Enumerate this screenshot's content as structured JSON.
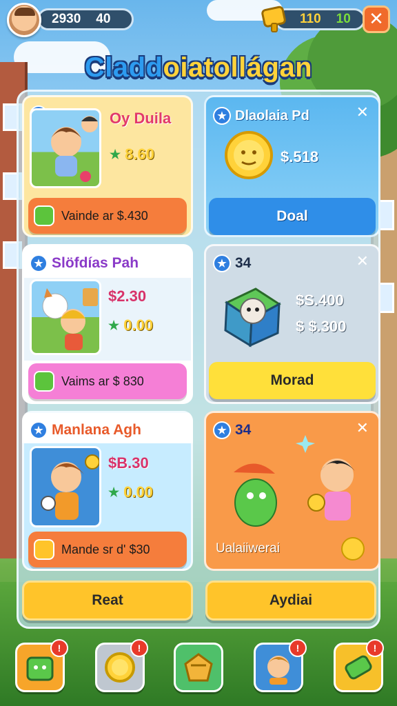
{
  "top_bar": {
    "coins_value": "2930",
    "coins_secondary": "40",
    "resource_a": "110",
    "resource_b": "10",
    "close_glyph": "✕"
  },
  "title": {
    "part1": "Cladd",
    "part2": "oiatollágan"
  },
  "cards": [
    {
      "title": "Oy Duila",
      "star_price": "8.60",
      "bar_label": "Vainde ar $.430",
      "colors": {
        "bg": "#fde6a0",
        "bar": "#f57d3c"
      }
    },
    {
      "title": "Dlaolaia Pd",
      "price": "$.518",
      "button_label": "Doal",
      "colors": {
        "bg": "#6cc0f2",
        "button": "#2f8ee8"
      }
    },
    {
      "title": "Slöfdías Pah",
      "price": "$2.30",
      "star_price": "0.00",
      "bar_label": "Vaims ar $ 830",
      "colors": {
        "bg": "#ffffff",
        "bar": "#f57fd6"
      }
    },
    {
      "title": "34",
      "price_1": "$S.400",
      "price_2": "$ $.300",
      "button_label": "Morad",
      "colors": {
        "bg": "#cfdce6",
        "button": "#ffe03a"
      }
    },
    {
      "title": "Manlana Agh",
      "price": "$B.30",
      "star_price": "0.00",
      "bar_label": "Mande sr d' $30",
      "colors": {
        "bg": "#c7ecff",
        "bar": "#f57d3c"
      }
    },
    {
      "title": "34",
      "bar_label": "Ualaiiwerai",
      "colors": {
        "bg": "#f99a49"
      }
    }
  ],
  "bottom_buttons": {
    "left": "Reat",
    "right": "Aydiai"
  },
  "nav": [
    {
      "icon": "gift-box-icon",
      "badge": "!"
    },
    {
      "icon": "gold-medal-icon",
      "badge": "!"
    },
    {
      "icon": "treasure-icon",
      "badge": ""
    },
    {
      "icon": "friend-avatar-icon",
      "badge": "!"
    },
    {
      "icon": "ticket-icon",
      "badge": "!"
    }
  ]
}
